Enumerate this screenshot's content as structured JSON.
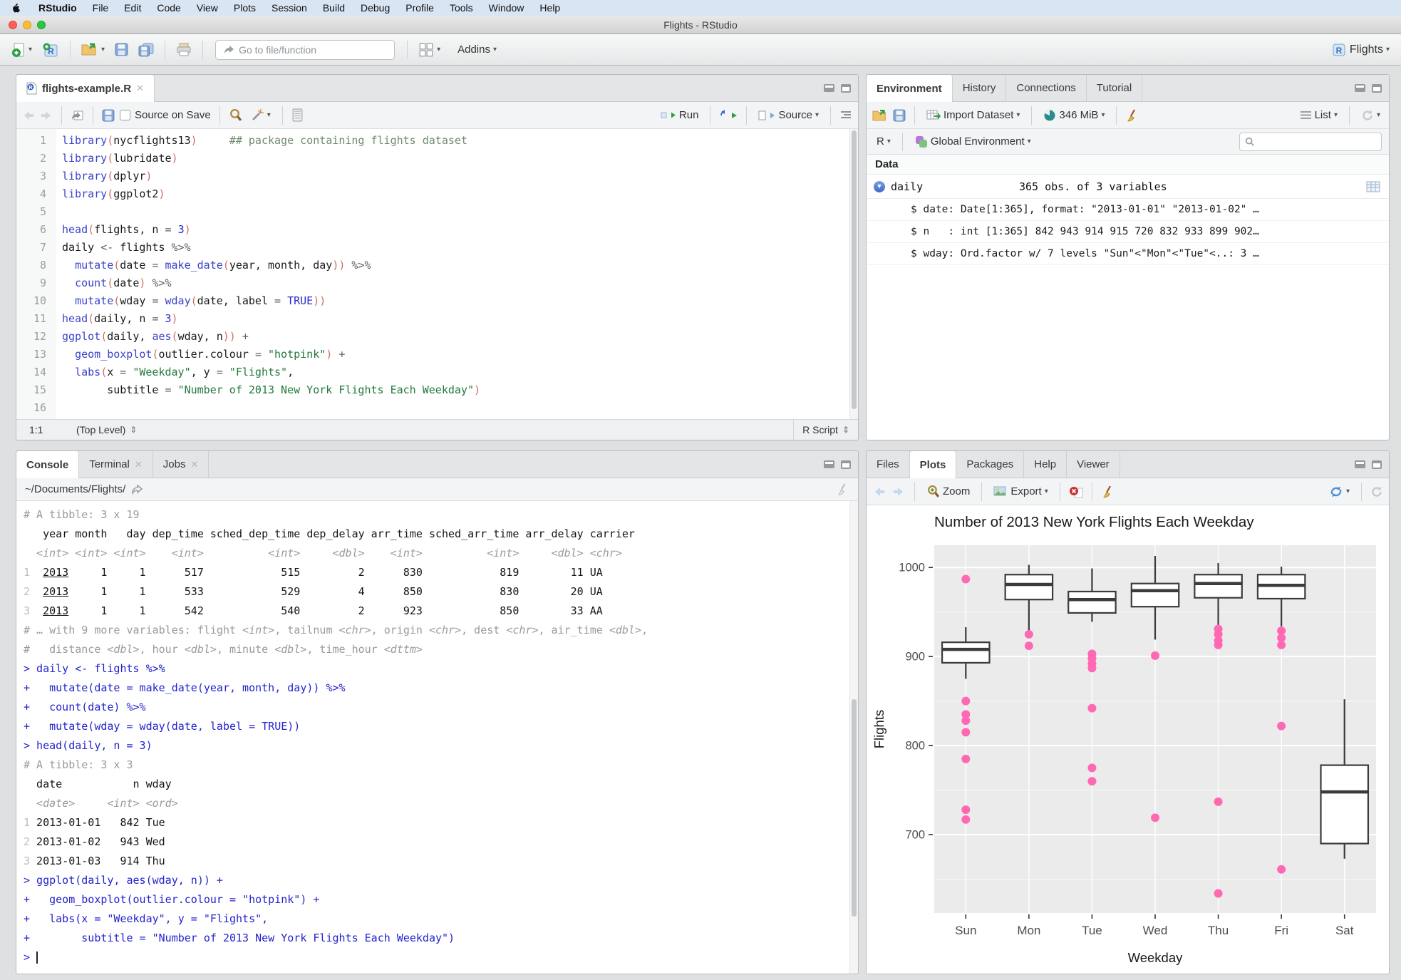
{
  "menu_bar": {
    "items": [
      "RStudio",
      "File",
      "Edit",
      "Code",
      "View",
      "Plots",
      "Session",
      "Build",
      "Debug",
      "Profile",
      "Tools",
      "Window",
      "Help"
    ]
  },
  "window": {
    "title": "Flights - RStudio"
  },
  "main_toolbar": {
    "goto_placeholder": "Go to file/function",
    "addins_label": "Addins",
    "project_label": "Flights"
  },
  "source_pane": {
    "tab_title": "flights-example.R",
    "toolbar": {
      "source_on_save": "Source on Save",
      "run_label": "Run",
      "source_label": "Source"
    },
    "status": {
      "position": "1:1",
      "scope": "(Top Level)",
      "doc_type": "R Script"
    },
    "code_lines": [
      [
        [
          "fn",
          "library"
        ],
        [
          "p",
          "("
        ],
        [
          "id",
          "nycflights13"
        ],
        [
          "p",
          ")"
        ],
        [
          "id",
          "     "
        ],
        [
          "com",
          "## package containing flights dataset"
        ]
      ],
      [
        [
          "fn",
          "library"
        ],
        [
          "p",
          "("
        ],
        [
          "id",
          "lubridate"
        ],
        [
          "p",
          ")"
        ]
      ],
      [
        [
          "fn",
          "library"
        ],
        [
          "p",
          "("
        ],
        [
          "id",
          "dplyr"
        ],
        [
          "p",
          ")"
        ]
      ],
      [
        [
          "fn",
          "library"
        ],
        [
          "p",
          "("
        ],
        [
          "id",
          "ggplot2"
        ],
        [
          "p",
          ")"
        ]
      ],
      [],
      [
        [
          "fn",
          "head"
        ],
        [
          "p",
          "("
        ],
        [
          "id",
          "flights, n "
        ],
        [
          "op",
          "= "
        ],
        [
          "num",
          "3"
        ],
        [
          "p",
          ")"
        ]
      ],
      [
        [
          "id",
          "daily "
        ],
        [
          "op",
          "<-"
        ],
        [
          "id",
          " flights "
        ],
        [
          "op",
          "%>%"
        ]
      ],
      [
        [
          "id",
          "  "
        ],
        [
          "fn",
          "mutate"
        ],
        [
          "p",
          "("
        ],
        [
          "id",
          "date "
        ],
        [
          "op",
          "= "
        ],
        [
          "fn",
          "make_date"
        ],
        [
          "p",
          "("
        ],
        [
          "id",
          "year, month, day"
        ],
        [
          "p",
          "))"
        ],
        [
          "id",
          " "
        ],
        [
          "op",
          "%>%"
        ]
      ],
      [
        [
          "id",
          "  "
        ],
        [
          "fn",
          "count"
        ],
        [
          "p",
          "("
        ],
        [
          "id",
          "date"
        ],
        [
          "p",
          ")"
        ],
        [
          "id",
          " "
        ],
        [
          "op",
          "%>%"
        ]
      ],
      [
        [
          "id",
          "  "
        ],
        [
          "fn",
          "mutate"
        ],
        [
          "p",
          "("
        ],
        [
          "id",
          "wday "
        ],
        [
          "op",
          "= "
        ],
        [
          "fn",
          "wday"
        ],
        [
          "p",
          "("
        ],
        [
          "id",
          "date, label "
        ],
        [
          "op",
          "= "
        ],
        [
          "kw",
          "TRUE"
        ],
        [
          "p",
          "))"
        ]
      ],
      [
        [
          "fn",
          "head"
        ],
        [
          "p",
          "("
        ],
        [
          "id",
          "daily, n "
        ],
        [
          "op",
          "= "
        ],
        [
          "num",
          "3"
        ],
        [
          "p",
          ")"
        ]
      ],
      [
        [
          "fn",
          "ggplot"
        ],
        [
          "p",
          "("
        ],
        [
          "id",
          "daily, "
        ],
        [
          "fn",
          "aes"
        ],
        [
          "p",
          "("
        ],
        [
          "id",
          "wday, n"
        ],
        [
          "p",
          "))"
        ],
        [
          "id",
          " "
        ],
        [
          "op",
          "+"
        ]
      ],
      [
        [
          "id",
          "  "
        ],
        [
          "fn",
          "geom_boxplot"
        ],
        [
          "p",
          "("
        ],
        [
          "id",
          "outlier.colour "
        ],
        [
          "op",
          "= "
        ],
        [
          "str",
          "\"hotpink\""
        ],
        [
          "p",
          ")"
        ],
        [
          "id",
          " "
        ],
        [
          "op",
          "+"
        ]
      ],
      [
        [
          "id",
          "  "
        ],
        [
          "fn",
          "labs"
        ],
        [
          "p",
          "("
        ],
        [
          "id",
          "x "
        ],
        [
          "op",
          "= "
        ],
        [
          "str",
          "\"Weekday\""
        ],
        [
          "id",
          ", y "
        ],
        [
          "op",
          "= "
        ],
        [
          "str",
          "\"Flights\""
        ],
        [
          "id",
          ","
        ]
      ],
      [
        [
          "id",
          "       subtitle "
        ],
        [
          "op",
          "= "
        ],
        [
          "str",
          "\"Number of 2013 New York Flights Each Weekday\""
        ],
        [
          "p",
          ")"
        ]
      ],
      []
    ]
  },
  "console_pane": {
    "tabs": [
      {
        "label": "Console",
        "active": true,
        "closable": false
      },
      {
        "label": "Terminal",
        "active": false,
        "closable": true
      },
      {
        "label": "Jobs",
        "active": false,
        "closable": true
      }
    ],
    "path": "~/Documents/Flights/",
    "lines": [
      [
        [
          "meta",
          "# A tibble: 3 x 19"
        ]
      ],
      [
        [
          "out",
          "   year month   day dep_time sched_dep_time dep_delay arr_time sched_arr_time arr_delay carrier"
        ]
      ],
      [
        [
          "typ",
          "  <int> <int> <int>    <int>          <int>     <dbl>    <int>          <int>     <dbl> <chr>"
        ]
      ],
      [
        [
          "idx",
          "1"
        ],
        [
          "out",
          "  "
        ],
        [
          "und",
          "2013"
        ],
        [
          "out",
          "     1     1      517            515         2      830            819        11 UA"
        ]
      ],
      [
        [
          "idx",
          "2"
        ],
        [
          "out",
          "  "
        ],
        [
          "und",
          "2013"
        ],
        [
          "out",
          "     1     1      533            529         4      850            830        20 UA"
        ]
      ],
      [
        [
          "idx",
          "3"
        ],
        [
          "out",
          "  "
        ],
        [
          "und",
          "2013"
        ],
        [
          "out",
          "     1     1      542            540         2      923            850        33 AA"
        ]
      ],
      [
        [
          "meta",
          "# … with 9 more variables: flight "
        ],
        [
          "typ",
          "<int>"
        ],
        [
          "meta",
          ", tailnum "
        ],
        [
          "typ",
          "<chr>"
        ],
        [
          "meta",
          ", origin "
        ],
        [
          "typ",
          "<chr>"
        ],
        [
          "meta",
          ", dest "
        ],
        [
          "typ",
          "<chr>"
        ],
        [
          "meta",
          ", air_time "
        ],
        [
          "typ",
          "<dbl>"
        ],
        [
          "meta",
          ","
        ]
      ],
      [
        [
          "meta",
          "#   distance "
        ],
        [
          "typ",
          "<dbl>"
        ],
        [
          "meta",
          ", hour "
        ],
        [
          "typ",
          "<dbl>"
        ],
        [
          "meta",
          ", minute "
        ],
        [
          "typ",
          "<dbl>"
        ],
        [
          "meta",
          ", time_hour "
        ],
        [
          "typ",
          "<dttm>"
        ]
      ],
      [
        [
          "cmd",
          "> daily <- flights %>%"
        ]
      ],
      [
        [
          "cmd",
          "+   mutate(date = make_date(year, month, day)) %>%"
        ]
      ],
      [
        [
          "cmd",
          "+   count(date) %>%"
        ]
      ],
      [
        [
          "cmd",
          "+   mutate(wday = wday(date, label = TRUE))"
        ]
      ],
      [
        [
          "cmd",
          "> head(daily, n = 3)"
        ]
      ],
      [
        [
          "meta",
          "# A tibble: 3 x 3"
        ]
      ],
      [
        [
          "out",
          "  date           n wday"
        ]
      ],
      [
        [
          "typ",
          "  <date>     <int> <ord>"
        ]
      ],
      [
        [
          "idx",
          "1"
        ],
        [
          "out",
          " 2013-01-01   842 Tue"
        ]
      ],
      [
        [
          "idx",
          "2"
        ],
        [
          "out",
          " 2013-01-02   943 Wed"
        ]
      ],
      [
        [
          "idx",
          "3"
        ],
        [
          "out",
          " 2013-01-03   914 Thu"
        ]
      ],
      [
        [
          "cmd",
          "> ggplot(daily, aes(wday, n)) +"
        ]
      ],
      [
        [
          "cmd",
          "+   geom_boxplot(outlier.colour = \"hotpink\") +"
        ]
      ],
      [
        [
          "cmd",
          "+   labs(x = \"Weekday\", y = \"Flights\","
        ]
      ],
      [
        [
          "cmd",
          "+        subtitle = \"Number of 2013 New York Flights Each Weekday\")"
        ]
      ],
      [
        [
          "cmd",
          "> "
        ],
        [
          "cursor",
          ""
        ]
      ]
    ]
  },
  "environment_pane": {
    "tabs": [
      {
        "label": "Environment",
        "active": true
      },
      {
        "label": "History",
        "active": false
      },
      {
        "label": "Connections",
        "active": false
      },
      {
        "label": "Tutorial",
        "active": false
      }
    ],
    "toolbar": {
      "import_label": "Import Dataset",
      "memory_label": "346 MiB",
      "list_label": "List"
    },
    "env_selector": {
      "language": "R",
      "scope": "Global Environment"
    },
    "data_header": "Data",
    "object": {
      "name": "daily",
      "summary": "365 obs. of 3 variables",
      "details": [
        "$ date: Date[1:365], format: \"2013-01-01\" \"2013-01-02\" …",
        "$ n   : int [1:365] 842 943 914 915 720 832 933 899 902…",
        "$ wday: Ord.factor w/ 7 levels \"Sun\"<\"Mon\"<\"Tue\"<..: 3 …"
      ]
    }
  },
  "plots_pane": {
    "tabs": [
      {
        "label": "Files",
        "active": false
      },
      {
        "label": "Plots",
        "active": true
      },
      {
        "label": "Packages",
        "active": false
      },
      {
        "label": "Help",
        "active": false
      },
      {
        "label": "Viewer",
        "active": false
      }
    ],
    "toolbar": {
      "zoom_label": "Zoom",
      "export_label": "Export"
    }
  },
  "chart_data": {
    "type": "boxplot",
    "title": "Number of 2013 New York Flights Each Weekday",
    "xlabel": "Weekday",
    "ylabel": "Flights",
    "categories": [
      "Sun",
      "Mon",
      "Tue",
      "Wed",
      "Thu",
      "Fri",
      "Sat"
    ],
    "y_ticks": [
      700,
      800,
      900,
      1000
    ],
    "y_minor_ticks": [
      650,
      750,
      850,
      950
    ],
    "ylim": [
      612,
      1025
    ],
    "panel_bg": "#EBEBEB",
    "grid": true,
    "legend": false,
    "outlier_color": "#FF69B4",
    "box_color": "#3b3b3b",
    "series": [
      {
        "category": "Sun",
        "whisker_low": 875,
        "q1": 893,
        "median": 908,
        "q3": 916,
        "whisker_high": 933,
        "outliers": [
          987,
          850,
          835,
          828,
          815,
          785,
          728,
          717
        ]
      },
      {
        "category": "Mon",
        "whisker_low": 926,
        "q1": 964,
        "median": 981,
        "q3": 992,
        "whisker_high": 1003,
        "outliers": [
          925,
          912
        ]
      },
      {
        "category": "Tue",
        "whisker_low": 939,
        "q1": 949,
        "median": 964,
        "q3": 973,
        "whisker_high": 999,
        "outliers": [
          903,
          898,
          892,
          887,
          842,
          775,
          760
        ]
      },
      {
        "category": "Wed",
        "whisker_low": 919,
        "q1": 956,
        "median": 974,
        "q3": 982,
        "whisker_high": 1013,
        "outliers": [
          901,
          719
        ]
      },
      {
        "category": "Thu",
        "whisker_low": 935,
        "q1": 966,
        "median": 982,
        "q3": 992,
        "whisker_high": 1005,
        "outliers": [
          931,
          925,
          918,
          913,
          737,
          634
        ]
      },
      {
        "category": "Fri",
        "whisker_low": 934,
        "q1": 965,
        "median": 980,
        "q3": 992,
        "whisker_high": 1001,
        "outliers": [
          929,
          921,
          913,
          822,
          661
        ]
      },
      {
        "category": "Sat",
        "whisker_low": 673,
        "q1": 690,
        "median": 748,
        "q3": 778,
        "whisker_high": 852,
        "outliers": []
      }
    ]
  }
}
